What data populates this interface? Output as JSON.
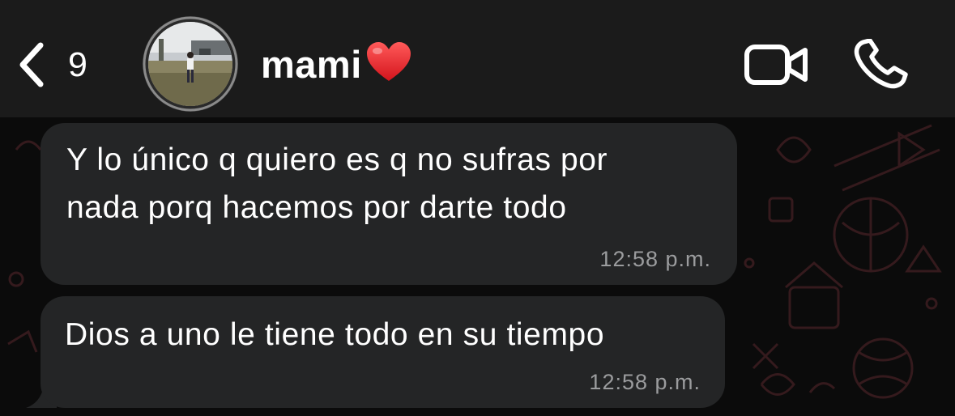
{
  "header": {
    "back_count": "9",
    "contact_name": "mami",
    "name_emoji_icon": "red-heart-icon",
    "avatar_icon": "profile-photo",
    "video_icon": "video-camera-icon",
    "call_icon": "phone-icon",
    "background_color": "#1b1b1b"
  },
  "chat": {
    "wallpaper_color": "#0b0b0b",
    "bubble_color": "#242526",
    "messages": [
      {
        "text": "Y lo único q quiero es q no sufras por\nnada porq hacemos por darte todo",
        "time": "12:58 p.m."
      },
      {
        "text": "Dios a uno le tiene todo en su tiempo",
        "time": "12:58 p.m."
      }
    ]
  }
}
